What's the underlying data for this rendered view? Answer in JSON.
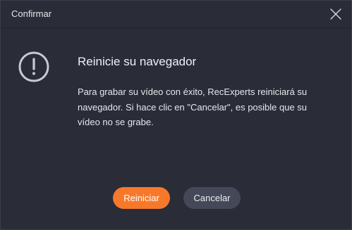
{
  "dialog": {
    "title": "Confirmar",
    "heading": "Reinicie su navegador",
    "message": "Para grabar su vídeo con éxito, RecExperts reiniciará su navegador. Si hace clic en \"Cancelar\", es posible que su vídeo no se grabe.",
    "primary_label": "Reiniciar",
    "secondary_label": "Cancelar"
  },
  "icons": {
    "close": "close-icon",
    "warning": "exclamation-circle-icon"
  },
  "colors": {
    "background": "#2a2c38",
    "accent": "#f8782a",
    "secondary_button": "#454858",
    "text": "#e6e7ec"
  }
}
